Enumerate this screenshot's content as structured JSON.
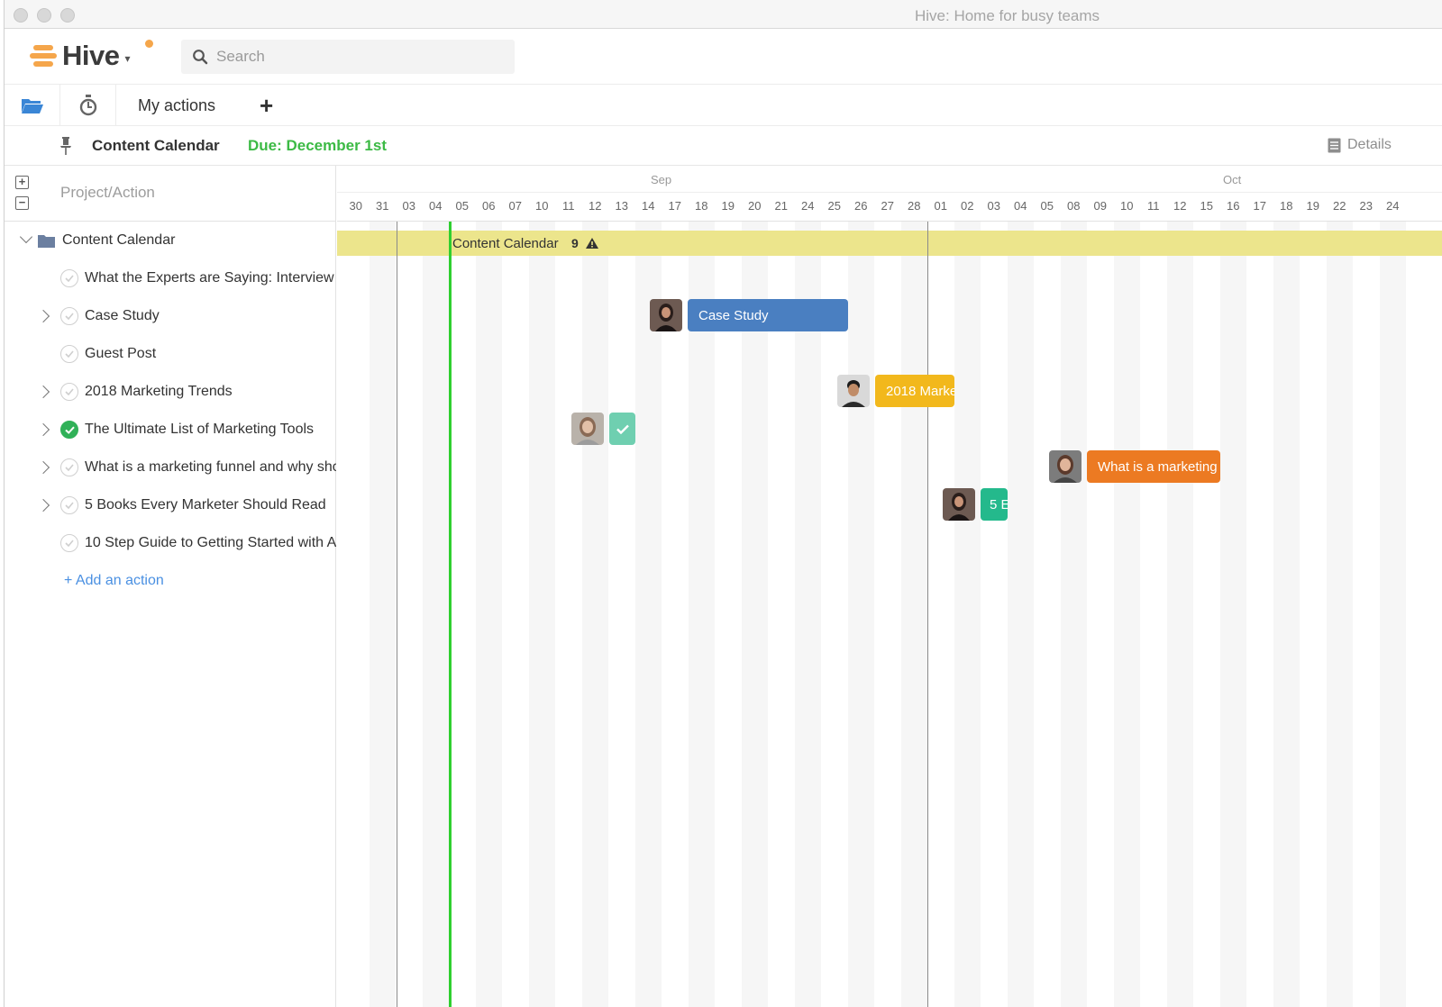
{
  "window": {
    "title": "Hive: Home for busy teams"
  },
  "header": {
    "logo": "Hive",
    "search_placeholder": "Search"
  },
  "toolbar": {
    "tab_label": "My actions",
    "add_label": "+"
  },
  "project": {
    "title": "Content Calendar",
    "due": "Due: December 1st",
    "details_label": "Details"
  },
  "left_panel": {
    "column_header": "Project/Action",
    "project_row": "Content Calendar",
    "rows": [
      {
        "label": "What the Experts are Saying: Interview",
        "expandable": false,
        "done": false
      },
      {
        "label": "Case Study",
        "expandable": true,
        "done": false
      },
      {
        "label": "Guest Post",
        "expandable": false,
        "done": false
      },
      {
        "label": "2018 Marketing Trends",
        "expandable": true,
        "done": false
      },
      {
        "label": "The Ultimate List of Marketing Tools",
        "expandable": true,
        "done": true
      },
      {
        "label": "What is a marketing funnel and why sho",
        "expandable": true,
        "done": false
      },
      {
        "label": "5 Books Every Marketer Should Read",
        "expandable": true,
        "done": false
      },
      {
        "label": "10 Step Guide to Getting Started with A",
        "expandable": false,
        "done": false
      }
    ],
    "add_action": "+ Add an action"
  },
  "timeline": {
    "months": [
      "Sep",
      "Oct"
    ],
    "days": [
      "30",
      "31",
      "03",
      "04",
      "05",
      "06",
      "07",
      "10",
      "11",
      "12",
      "13",
      "14",
      "17",
      "18",
      "19",
      "20",
      "21",
      "24",
      "25",
      "26",
      "27",
      "28",
      "01",
      "02",
      "03",
      "04",
      "05",
      "08",
      "09",
      "10",
      "11",
      "12",
      "15",
      "16",
      "17",
      "18",
      "19",
      "22",
      "23",
      "24"
    ],
    "project_bar": {
      "label": "Content Calendar",
      "count": "9"
    },
    "task_bars": [
      {
        "label": "Case Study",
        "color": "#4a7fc1"
      },
      {
        "label": "2018 Marke",
        "color": "#f2b81c"
      },
      {
        "label": "",
        "color": "#6fcfb0"
      },
      {
        "label": "What is a marketing",
        "color": "#ec7a22"
      },
      {
        "label": "5 E",
        "color": "#24b98c"
      }
    ]
  },
  "colors": {
    "accent": "#f5a64b",
    "due_green": "#3cba45",
    "today_line": "#2fcf2f",
    "project_band": "#ece58c"
  }
}
